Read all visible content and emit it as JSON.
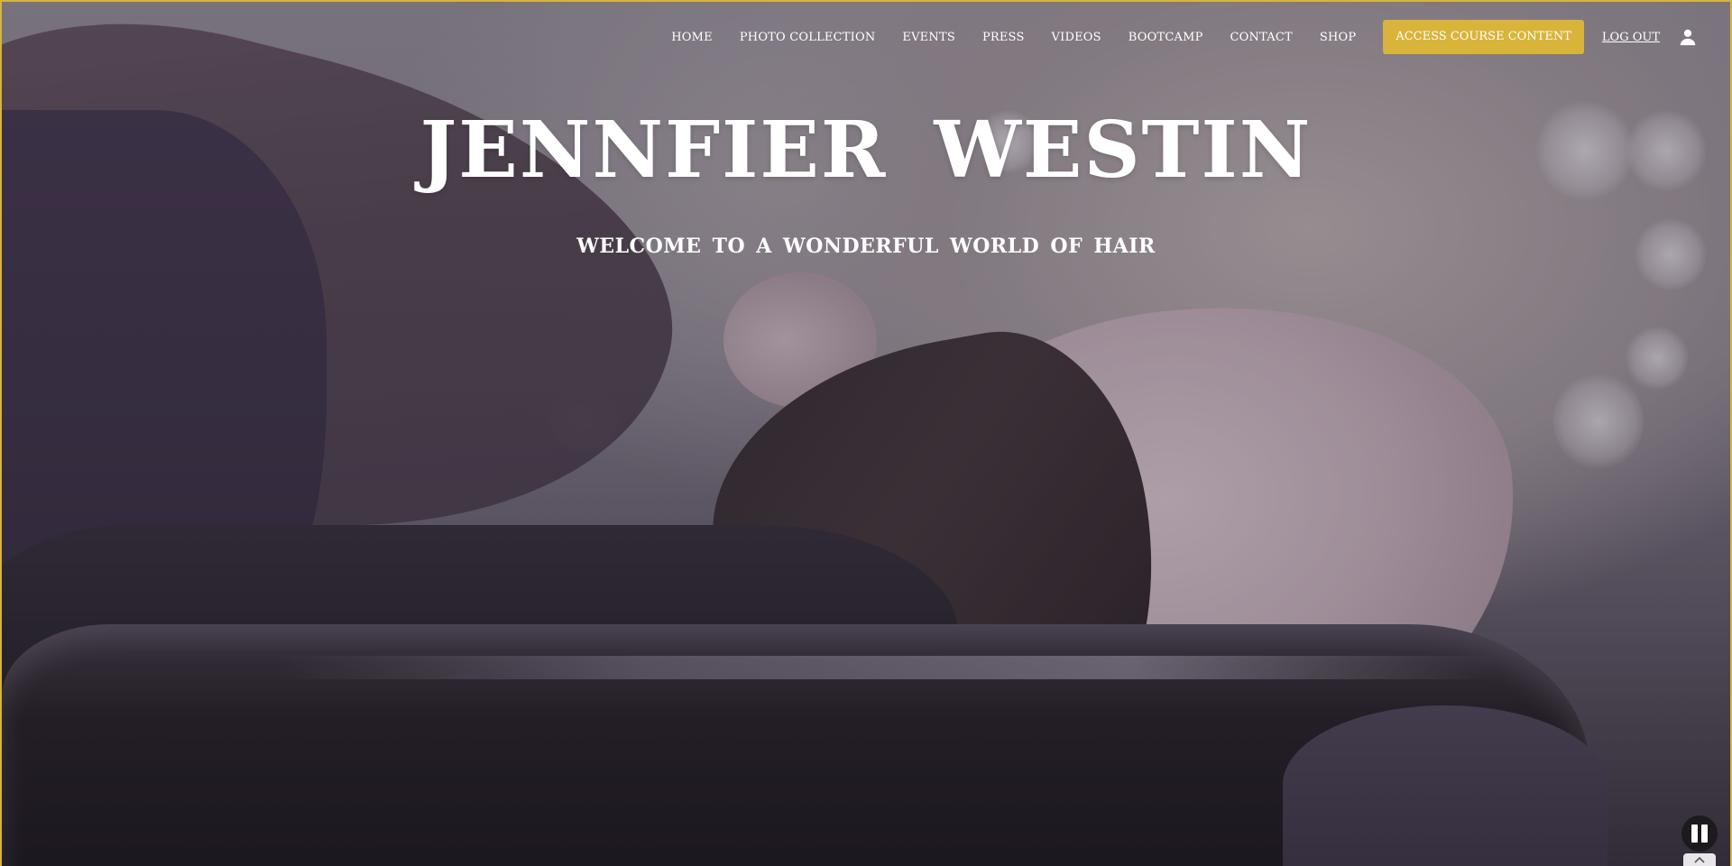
{
  "nav": {
    "items": [
      {
        "label": "HOME"
      },
      {
        "label": "PHOTO COLLECTION"
      },
      {
        "label": "EVENTS"
      },
      {
        "label": "PRESS"
      },
      {
        "label": "VIDEOS"
      },
      {
        "label": "BOOTCAMP"
      },
      {
        "label": "CONTACT"
      },
      {
        "label": "SHOP"
      }
    ],
    "cta_label": "ACCESS COURSE CONTENT",
    "logout_label": "LOG OUT",
    "user_icon": "user-icon"
  },
  "hero": {
    "title": "JENNFIER WESTIN",
    "subtitle": "WELCOME TO A WONDERFUL WORLD OF HAIR"
  },
  "controls": {
    "pause_icon": "pause-icon",
    "scroll_icon": "chevron-up-icon"
  },
  "colors": {
    "accent": "#d9b43a",
    "text": "#ffffff"
  }
}
